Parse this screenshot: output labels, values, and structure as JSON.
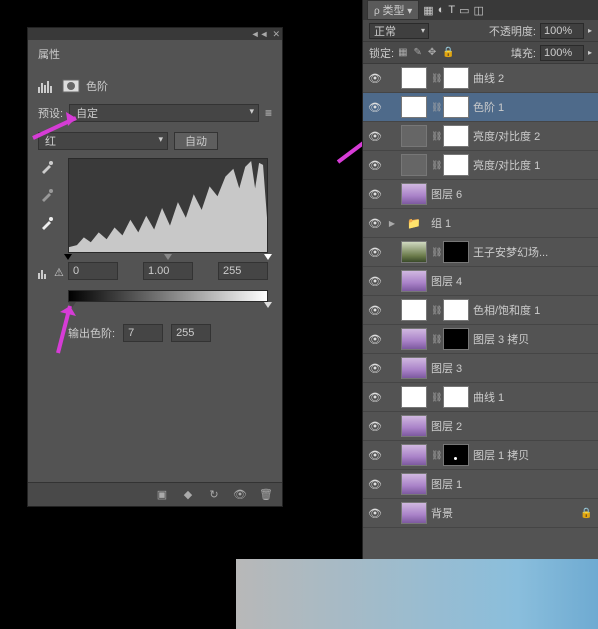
{
  "properties": {
    "title": "属性",
    "adjustment_name": "色阶",
    "preset_label": "预设:",
    "preset_value": "自定",
    "channel_value": "红",
    "auto_btn": "自动",
    "input_black": "0",
    "input_gamma": "1.00",
    "input_white": "255",
    "output_label": "输出色阶:",
    "output_black": "7",
    "output_white": "255",
    "collapse_glyph": "◄◄",
    "close_glyph": "✕"
  },
  "layers_panel": {
    "top_chip": "类型",
    "blend_mode": "正常",
    "opacity_label": "不透明度:",
    "opacity_value": "100%",
    "lock_label": "锁定:",
    "fill_label": "填充:",
    "fill_value": "100%"
  },
  "layers": [
    {
      "name": "曲线 2",
      "type": "adj",
      "mask": "white",
      "thumb": "white"
    },
    {
      "name": "色阶 1",
      "type": "adj",
      "mask": "white",
      "thumb": "white",
      "selected": true
    },
    {
      "name": "亮度/对比度 2",
      "type": "adj",
      "mask": "white",
      "thumb": "gray"
    },
    {
      "name": "亮度/对比度 1",
      "type": "adj",
      "mask": "white",
      "thumb": "gray"
    },
    {
      "name": "图层 6",
      "type": "img",
      "thumb": "photo"
    },
    {
      "name": "组 1",
      "type": "group"
    },
    {
      "name": "王子安梦幻场...",
      "type": "img",
      "mask": "black",
      "thumb": "grass"
    },
    {
      "name": "图层 4",
      "type": "img",
      "thumb": "photo"
    },
    {
      "name": "色相/饱和度 1",
      "type": "adj",
      "mask": "white",
      "thumb": "white"
    },
    {
      "name": "图层 3 拷贝",
      "type": "img",
      "mask": "tiny",
      "thumb": "photo"
    },
    {
      "name": "图层 3",
      "type": "img",
      "thumb": "photo"
    },
    {
      "name": "曲线 1",
      "type": "adj",
      "mask": "white",
      "thumb": "white"
    },
    {
      "name": "图层 2",
      "type": "img",
      "thumb": "photo"
    },
    {
      "name": "图层 1 拷贝",
      "type": "img",
      "mask": "dot",
      "thumb": "photo"
    },
    {
      "name": "图层 1",
      "type": "img",
      "thumb": "photo"
    },
    {
      "name": "背景",
      "type": "bg",
      "thumb": "photo",
      "locked": true
    }
  ]
}
